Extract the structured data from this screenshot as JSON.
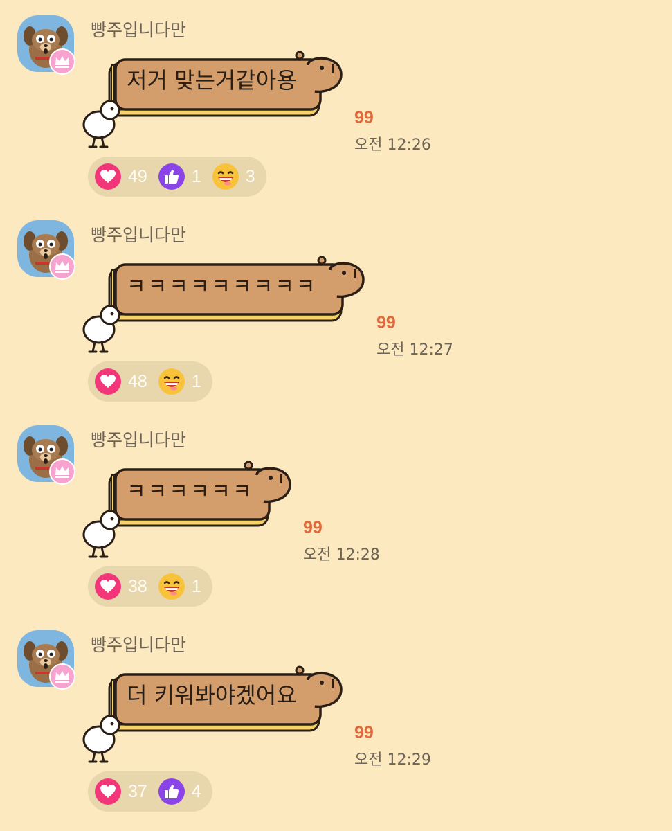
{
  "colors": {
    "background": "#fce9c0",
    "read_count": "#e4693a",
    "bubble_fill": "#d49d6c",
    "reaction_pill": "#e8d6ac"
  },
  "messages": [
    {
      "username": "빵주입니다만",
      "text": "저거 맞는거같아용",
      "read_count": "99",
      "time": "오전 12:26",
      "reactions": [
        {
          "icon": "heart-icon",
          "count": "49"
        },
        {
          "icon": "thumbs-up-icon",
          "count": "1"
        },
        {
          "icon": "laughing-face-icon",
          "count": "3"
        }
      ]
    },
    {
      "username": "빵주입니다만",
      "text": "ㅋㅋㅋㅋㅋㅋㅋㅋㅋ",
      "read_count": "99",
      "time": "오전 12:27",
      "reactions": [
        {
          "icon": "heart-icon",
          "count": "48"
        },
        {
          "icon": "laughing-face-icon",
          "count": "1"
        }
      ]
    },
    {
      "username": "빵주입니다만",
      "text": "ㅋㅋㅋㅋㅋㅋ",
      "read_count": "99",
      "time": "오전 12:28",
      "reactions": [
        {
          "icon": "heart-icon",
          "count": "38"
        },
        {
          "icon": "laughing-face-icon",
          "count": "1"
        }
      ]
    },
    {
      "username": "빵주입니다만",
      "text": "더 키워봐야겠어요",
      "read_count": "99",
      "time": "오전 12:29",
      "reactions": [
        {
          "icon": "heart-icon",
          "count": "37"
        },
        {
          "icon": "thumbs-up-icon",
          "count": "4"
        }
      ]
    }
  ]
}
